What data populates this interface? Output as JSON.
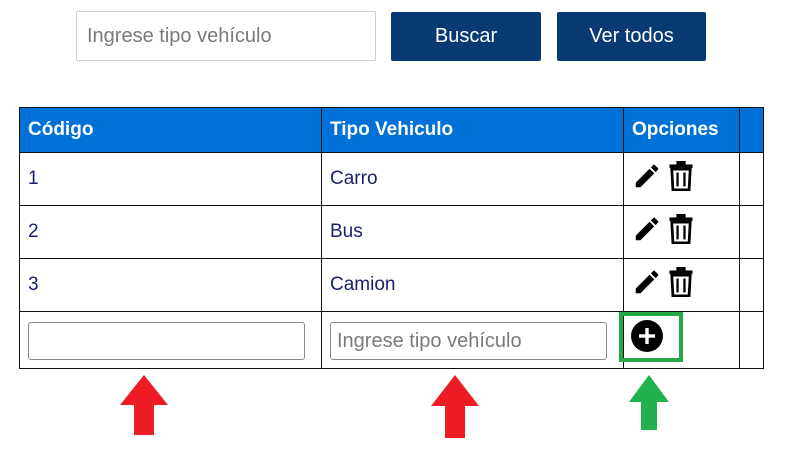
{
  "search": {
    "placeholder": "Ingrese tipo vehículo",
    "search_label": "Buscar",
    "view_all_label": "Ver todos"
  },
  "table": {
    "headers": [
      "Código",
      "Tipo Vehiculo",
      "Opciones",
      ""
    ],
    "rows": [
      {
        "code": "1",
        "type": "Carro"
      },
      {
        "code": "2",
        "type": "Bus"
      },
      {
        "code": "3",
        "type": "Camion"
      }
    ],
    "new_row": {
      "code_value": "",
      "type_placeholder": "Ingrese tipo vehículo"
    }
  },
  "icons": {
    "edit": "pencil-icon",
    "delete": "trash-icon",
    "add": "plus-circle-icon"
  },
  "annotations": {
    "arrow_red_color": "#ed1c24",
    "arrow_green_color": "#22b14c",
    "highlight_color": "#22a944"
  },
  "colors": {
    "header_bg": "#0071d7",
    "button_bg": "#0a3a73",
    "cell_text": "#1a1f6e"
  }
}
